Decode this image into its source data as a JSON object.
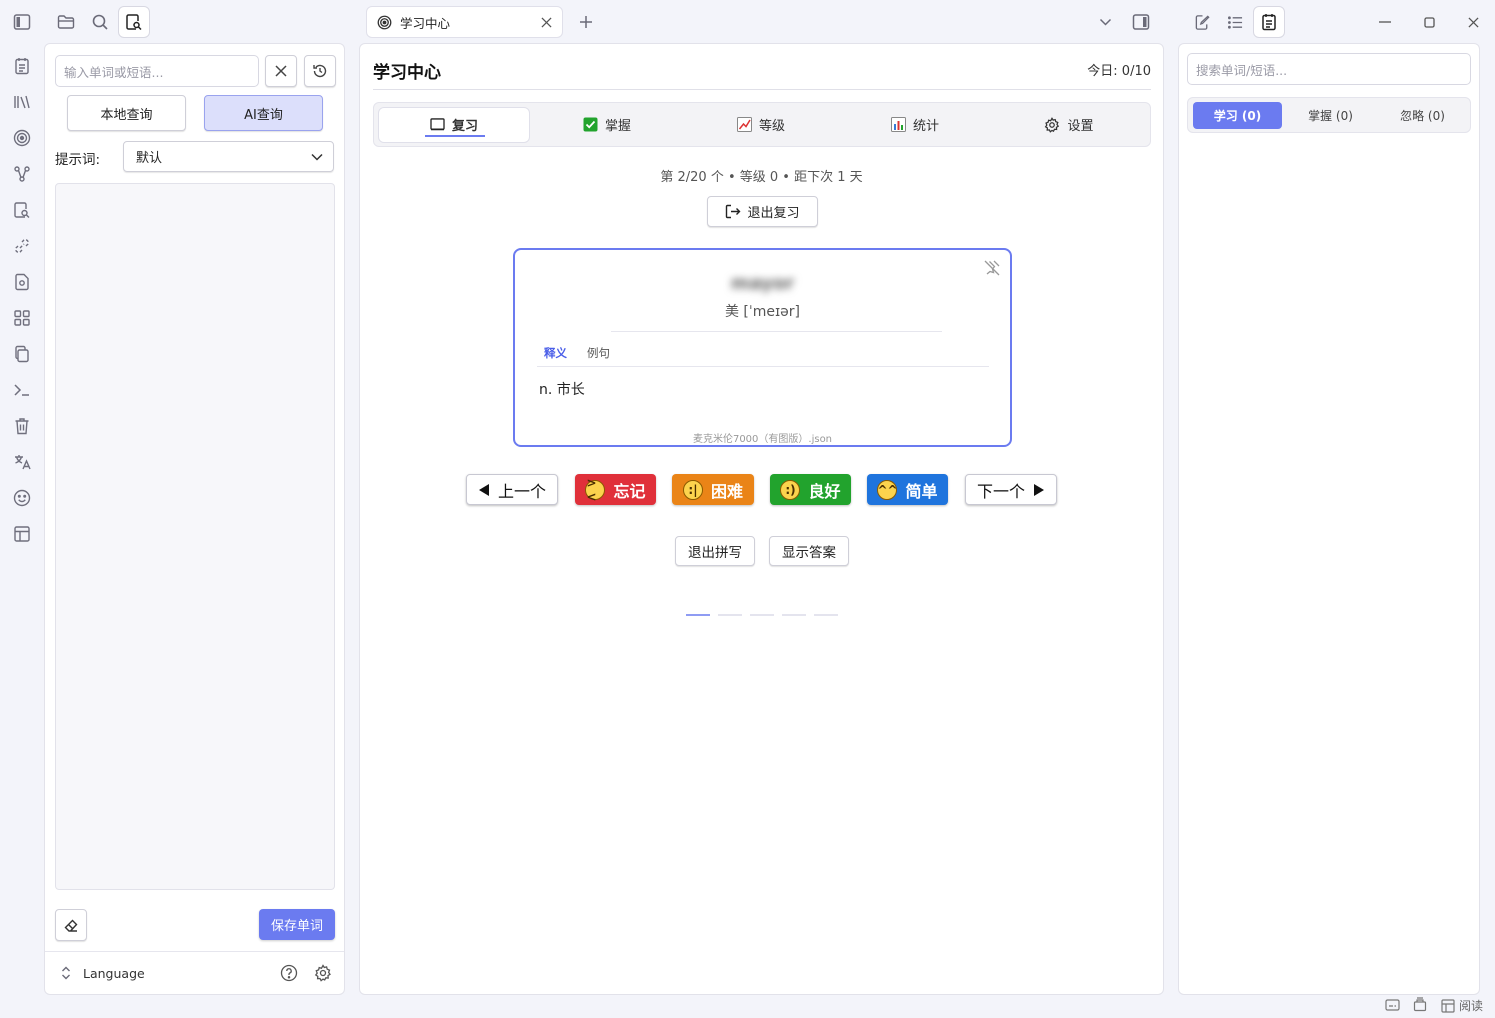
{
  "window": {
    "tab_title": "学习中心",
    "status_bar": {
      "read_label": "阅读"
    }
  },
  "left_panel": {
    "search_placeholder": "输入单词或短语...",
    "local_query_label": "本地查询",
    "ai_query_label": "AI查询",
    "prompt_label": "提示词:",
    "prompt_value": "默认",
    "save_button": "保存单词",
    "language_label": "Language"
  },
  "center": {
    "title": "学习中心",
    "today": "今日: 0/10",
    "tabs": [
      {
        "label": "复习",
        "icon": "book-icon",
        "active": true
      },
      {
        "label": "掌握",
        "icon": "check-icon",
        "active": false
      },
      {
        "label": "等级",
        "icon": "chart-line-icon",
        "active": false
      },
      {
        "label": "统计",
        "icon": "bar-chart-icon",
        "active": false
      },
      {
        "label": "设置",
        "icon": "gear-icon",
        "active": false
      }
    ],
    "progress_text": "第 2/20 个 • 等级 0 • 距下次 1 天",
    "exit_review": "退出复习",
    "card": {
      "word": "mayor",
      "phonetic": "美 [ˈmeɪər]",
      "tab_definition": "释义",
      "tab_example": "例句",
      "definition": "n. 市长",
      "source": "麦克米伦7000（有图版）.json"
    },
    "buttons": {
      "prev": "上一个",
      "forget": "忘记",
      "hard": "困难",
      "good": "良好",
      "easy": "简单",
      "next": "下一个",
      "exit_spell": "退出拼写",
      "show_answer": "显示答案"
    },
    "colors": {
      "forget": "#e0303a",
      "hard": "#ea8417",
      "good": "#22a32d",
      "easy": "#1f74dd",
      "accent": "#6b7bf0"
    }
  },
  "right_panel": {
    "search_placeholder": "搜索单词/短语...",
    "tabs": [
      {
        "label": "学习 (0)",
        "active": true
      },
      {
        "label": "掌握 (0)",
        "active": false
      },
      {
        "label": "忽略 (0)",
        "active": false
      }
    ]
  }
}
